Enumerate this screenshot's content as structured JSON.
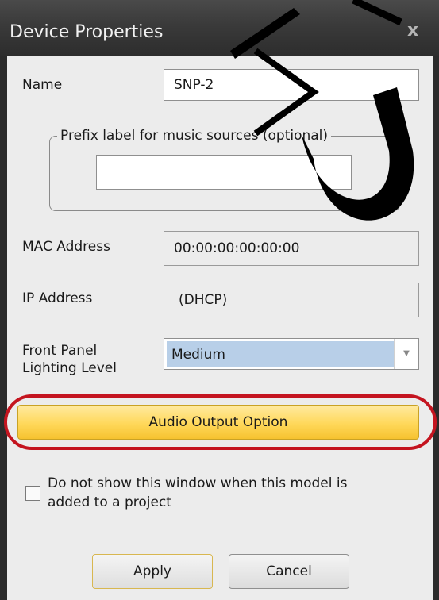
{
  "window": {
    "title": "Device Properties",
    "close_glyph": "x"
  },
  "fields": {
    "name_label": "Name",
    "name_value": "SNP-2",
    "prefix_legend": "Prefix label for music sources (optional)",
    "prefix_value": "",
    "mac_label": "MAC Address",
    "mac_value": "00:00:00:00:00:00",
    "ip_label": "IP Address",
    "ip_value": "(DHCP)",
    "lighting_label_line1": "Front Panel",
    "lighting_label_line2": "Lighting Level",
    "lighting_value": "Medium"
  },
  "actions": {
    "audio_output": "Audio Output Option",
    "checkbox_line1": "Do not show this window when this model is",
    "checkbox_line2": "added to a project",
    "checkbox_checked": false,
    "apply": "Apply",
    "cancel": "Cancel"
  },
  "colors": {
    "highlight_ring": "#c4141f",
    "primary_button": "#ffd85a",
    "selection": "#b8cfe8"
  }
}
